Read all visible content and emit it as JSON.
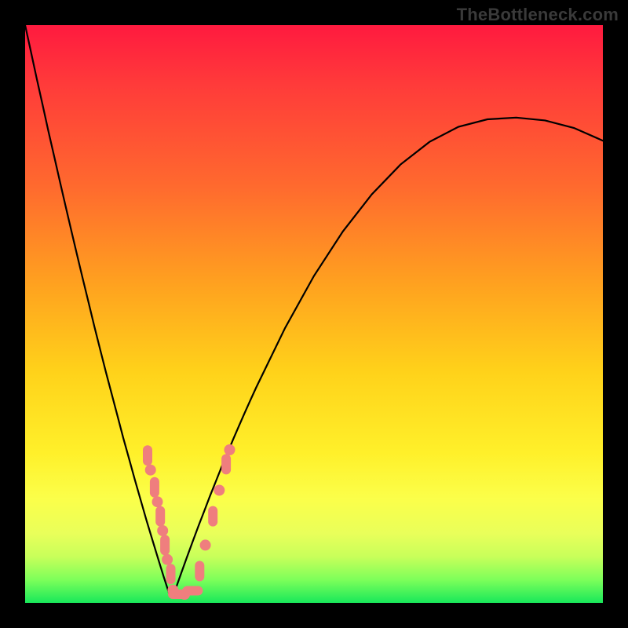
{
  "watermark": "TheBottleneck.com",
  "colors": {
    "frame": "#000000",
    "gradient_top": "#ff1a3f",
    "gradient_mid": "#ffd21a",
    "gradient_bottom": "#18e85a",
    "curve": "#000000",
    "marker_fill": "#ef7e7e",
    "marker_stroke": "#d46464"
  },
  "chart_data": {
    "type": "line",
    "title": "",
    "xlabel": "",
    "ylabel": "",
    "xlim": [
      0,
      100
    ],
    "ylim": [
      0,
      100
    ],
    "x": [
      0,
      1,
      2,
      3,
      4,
      5,
      6,
      7,
      8,
      9,
      10,
      11,
      12,
      13,
      14,
      15,
      16,
      17,
      18,
      19,
      20,
      21,
      22,
      23,
      24,
      25,
      26,
      27,
      28,
      29,
      30,
      31,
      32,
      33,
      34,
      35,
      36,
      37,
      38,
      39,
      40,
      45,
      50,
      55,
      60,
      65,
      70,
      75,
      80,
      85,
      90,
      95,
      100
    ],
    "y": [
      100,
      95.4,
      90.8,
      86.3,
      81.8,
      77.4,
      73.0,
      68.7,
      64.4,
      60.2,
      56.0,
      51.9,
      47.8,
      43.8,
      39.9,
      36.1,
      32.3,
      28.5,
      24.9,
      21.3,
      17.8,
      14.3,
      11.0,
      7.7,
      4.5,
      1.4,
      2.3,
      5.1,
      7.9,
      10.6,
      13.3,
      15.9,
      18.5,
      21.0,
      23.5,
      25.9,
      28.3,
      30.6,
      32.9,
      35.1,
      37.3,
      47.6,
      56.6,
      64.3,
      70.7,
      75.9,
      79.8,
      82.4,
      83.7,
      84.0,
      83.5,
      82.2,
      80.0
    ],
    "minimum_x": 25,
    "markers_left": [
      {
        "x_pct": 21.2,
        "y_pct": 25.5,
        "shape": "vcap"
      },
      {
        "x_pct": 21.7,
        "y_pct": 23.0,
        "shape": "dot"
      },
      {
        "x_pct": 22.4,
        "y_pct": 20.0,
        "shape": "vcap"
      },
      {
        "x_pct": 22.9,
        "y_pct": 17.5,
        "shape": "dot"
      },
      {
        "x_pct": 23.4,
        "y_pct": 15.0,
        "shape": "vcap"
      },
      {
        "x_pct": 23.8,
        "y_pct": 12.5,
        "shape": "dot"
      },
      {
        "x_pct": 24.2,
        "y_pct": 10.0,
        "shape": "vcap"
      },
      {
        "x_pct": 24.6,
        "y_pct": 7.5,
        "shape": "dot"
      },
      {
        "x_pct": 25.2,
        "y_pct": 5.0,
        "shape": "vcap"
      }
    ],
    "markers_bottom": [
      {
        "x_pct": 25.6,
        "y_pct": 2.2,
        "shape": "dot"
      },
      {
        "x_pct": 26.5,
        "y_pct": 1.5,
        "shape": "hcap"
      },
      {
        "x_pct": 27.6,
        "y_pct": 1.5,
        "shape": "dot"
      },
      {
        "x_pct": 29.0,
        "y_pct": 2.1,
        "shape": "hcap"
      }
    ],
    "markers_right": [
      {
        "x_pct": 30.2,
        "y_pct": 5.5,
        "shape": "vcap"
      },
      {
        "x_pct": 31.2,
        "y_pct": 10.0,
        "shape": "dot"
      },
      {
        "x_pct": 32.5,
        "y_pct": 15.0,
        "shape": "vcap"
      },
      {
        "x_pct": 33.6,
        "y_pct": 19.5,
        "shape": "dot"
      },
      {
        "x_pct": 34.8,
        "y_pct": 24.0,
        "shape": "vcap"
      },
      {
        "x_pct": 35.4,
        "y_pct": 26.5,
        "shape": "dot"
      }
    ]
  }
}
